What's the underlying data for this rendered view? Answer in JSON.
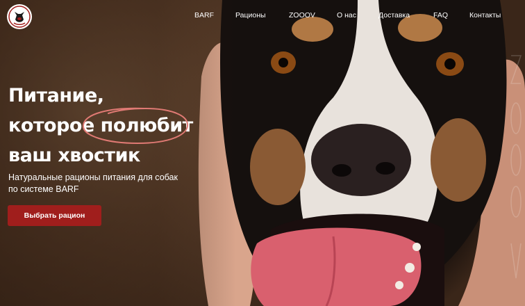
{
  "header": {
    "nav": [
      {
        "label": "BARF"
      },
      {
        "label": "Рационы"
      },
      {
        "label": "ZOOOV"
      },
      {
        "label": "О нас"
      },
      {
        "label": "Доставка"
      },
      {
        "label": "FAQ"
      },
      {
        "label": "Контакты"
      }
    ]
  },
  "hero": {
    "title_line1": "Питание,",
    "title_line2": "которое полюбит",
    "title_line3": "ваш хвостик",
    "subtitle": "Натуральные рационы питания для собак по системе BARF",
    "cta_label": "Выбрать рацион"
  },
  "colors": {
    "accent": "#a01e1c",
    "highlight_circle": "#e07a74",
    "text": "#ffffff"
  },
  "icons": {
    "logo": "dog-logo-icon",
    "highlight": "hand-drawn-circle"
  }
}
